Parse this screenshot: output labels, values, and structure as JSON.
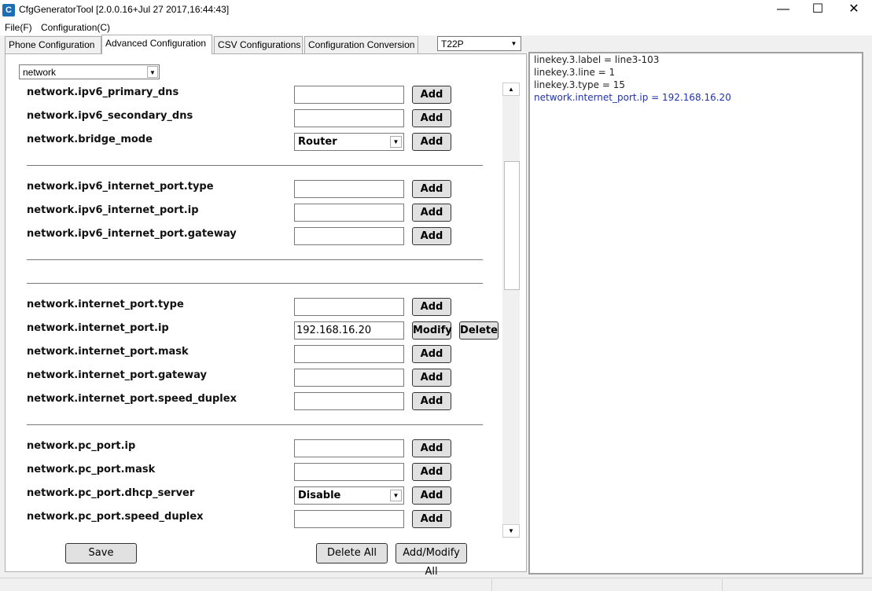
{
  "window": {
    "title": "CfgGeneratorTool [2.0.0.16+Jul 27 2017,16:44:43]",
    "icon_letter": "C",
    "minimize": "—",
    "maximize": "☐",
    "close": "✕"
  },
  "menu": {
    "file": "File(F)",
    "configuration": "Configuration(C)"
  },
  "tabs": {
    "phone": "Phone Configuration",
    "advanced": "Advanced Configuration",
    "csv": "CSV Configurations",
    "conversion": "Configuration Conversion"
  },
  "model_select": {
    "value": "T22P"
  },
  "category_select": {
    "value": "network"
  },
  "rows": {
    "ipv6_primary_dns": {
      "label": "network.ipv6_primary_dns",
      "value": "",
      "button": "Add"
    },
    "ipv6_secondary_dns": {
      "label": "network.ipv6_secondary_dns",
      "value": "",
      "button": "Add"
    },
    "bridge_mode": {
      "label": "network.bridge_mode",
      "value": "Router",
      "button": "Add"
    },
    "ipv6_internet_port_type": {
      "label": "network.ipv6_internet_port.type",
      "value": "",
      "button": "Add"
    },
    "ipv6_internet_port_ip": {
      "label": "network.ipv6_internet_port.ip",
      "value": "",
      "button": "Add"
    },
    "ipv6_internet_port_gateway": {
      "label": "network.ipv6_internet_port.gateway",
      "value": "",
      "button": "Add"
    },
    "internet_port_type": {
      "label": "network.internet_port.type",
      "value": "",
      "button": "Add"
    },
    "internet_port_ip": {
      "label": "network.internet_port.ip",
      "value": "192.168.16.20",
      "button": "Modify",
      "button2": "Delete"
    },
    "internet_port_mask": {
      "label": "network.internet_port.mask",
      "value": "",
      "button": "Add"
    },
    "internet_port_gateway": {
      "label": "network.internet_port.gateway",
      "value": "",
      "button": "Add"
    },
    "internet_port_speed_duplex": {
      "label": "network.internet_port.speed_duplex",
      "value": "",
      "button": "Add"
    },
    "pc_port_ip": {
      "label": "network.pc_port.ip",
      "value": "",
      "button": "Add"
    },
    "pc_port_mask": {
      "label": "network.pc_port.mask",
      "value": "",
      "button": "Add"
    },
    "pc_port_dhcp_server": {
      "label": "network.pc_port.dhcp_server",
      "value": "Disable",
      "button": "Add"
    },
    "pc_port_speed_duplex": {
      "label": "network.pc_port.speed_duplex",
      "value": "",
      "button": "Add"
    }
  },
  "bottom_buttons": {
    "save": "Save",
    "delete_all": "Delete All",
    "add_modify_all": "Add/Modify All"
  },
  "config_lines": [
    "linekey.3.label = line3-103",
    "linekey.3.line = 1",
    "linekey.3.type = 15",
    "network.internet_port.ip = 192.168.16.20"
  ],
  "colors": {
    "highlight_line": "#2233aa",
    "app_icon": "#1d6fb5"
  }
}
